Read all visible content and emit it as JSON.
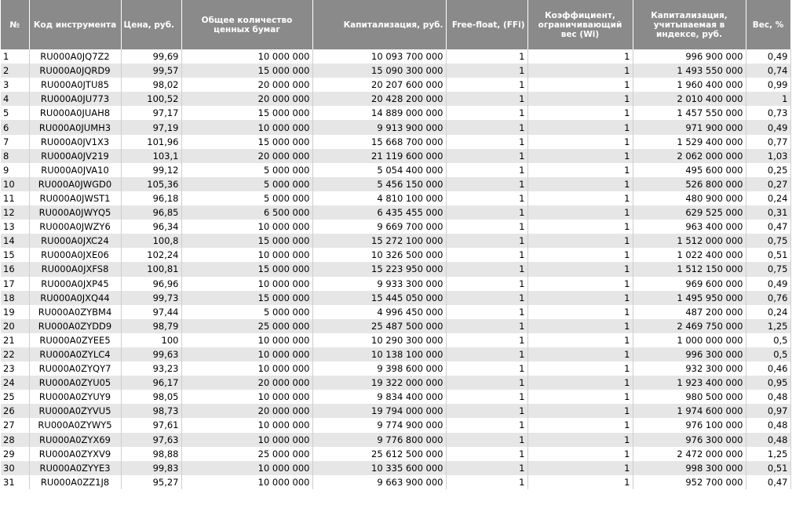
{
  "headers": [
    "№",
    "Код инструмента",
    "Цена, руб.",
    "Общее количество ценных бумаг",
    "Капитализация, руб.",
    "Free-float, (FFi)",
    "Коэффициент, ограничивающий вес (Wi)",
    "Капитализация, учитываемая в индексе, руб.",
    "Вес, %"
  ],
  "rows": [
    [
      "1",
      "RU000A0JQ7Z2",
      "99,69",
      "10 000 000",
      "10 093 700 000",
      "1",
      "1",
      "996 900 000",
      "0,49"
    ],
    [
      "2",
      "RU000A0JQRD9",
      "99,57",
      "15 000 000",
      "15 090 300 000",
      "1",
      "1",
      "1 493 550 000",
      "0,74"
    ],
    [
      "3",
      "RU000A0JTU85",
      "98,02",
      "20 000 000",
      "20 207 600 000",
      "1",
      "1",
      "1 960 400 000",
      "0,99"
    ],
    [
      "4",
      "RU000A0JU773",
      "100,52",
      "20 000 000",
      "20 428 200 000",
      "1",
      "1",
      "2 010 400 000",
      "1"
    ],
    [
      "5",
      "RU000A0JUAH8",
      "97,17",
      "15 000 000",
      "14 889 000 000",
      "1",
      "1",
      "1 457 550 000",
      "0,73"
    ],
    [
      "6",
      "RU000A0JUMH3",
      "97,19",
      "10 000 000",
      "9 913 900 000",
      "1",
      "1",
      "971 900 000",
      "0,49"
    ],
    [
      "7",
      "RU000A0JV1X3",
      "101,96",
      "15 000 000",
      "15 668 700 000",
      "1",
      "1",
      "1 529 400 000",
      "0,77"
    ],
    [
      "8",
      "RU000A0JV219",
      "103,1",
      "20 000 000",
      "21 119 600 000",
      "1",
      "1",
      "2 062 000 000",
      "1,03"
    ],
    [
      "9",
      "RU000A0JVA10",
      "99,12",
      "5 000 000",
      "5 054 400 000",
      "1",
      "1",
      "495 600 000",
      "0,25"
    ],
    [
      "10",
      "RU000A0JWGD0",
      "105,36",
      "5 000 000",
      "5 456 150 000",
      "1",
      "1",
      "526 800 000",
      "0,27"
    ],
    [
      "11",
      "RU000A0JWST1",
      "96,18",
      "5 000 000",
      "4 810 100 000",
      "1",
      "1",
      "480 900 000",
      "0,24"
    ],
    [
      "12",
      "RU000A0JWYQ5",
      "96,85",
      "6 500 000",
      "6 435 455 000",
      "1",
      "1",
      "629 525 000",
      "0,31"
    ],
    [
      "13",
      "RU000A0JWZY6",
      "96,34",
      "10 000 000",
      "9 669 700 000",
      "1",
      "1",
      "963 400 000",
      "0,47"
    ],
    [
      "14",
      "RU000A0JXC24",
      "100,8",
      "15 000 000",
      "15 272 100 000",
      "1",
      "1",
      "1 512 000 000",
      "0,75"
    ],
    [
      "15",
      "RU000A0JXE06",
      "102,24",
      "10 000 000",
      "10 326 500 000",
      "1",
      "1",
      "1 022 400 000",
      "0,51"
    ],
    [
      "16",
      "RU000A0JXFS8",
      "100,81",
      "15 000 000",
      "15 223 950 000",
      "1",
      "1",
      "1 512 150 000",
      "0,75"
    ],
    [
      "17",
      "RU000A0JXP45",
      "96,96",
      "10 000 000",
      "9 933 300 000",
      "1",
      "1",
      "969 600 000",
      "0,49"
    ],
    [
      "18",
      "RU000A0JXQ44",
      "99,73",
      "15 000 000",
      "15 445 050 000",
      "1",
      "1",
      "1 495 950 000",
      "0,76"
    ],
    [
      "19",
      "RU000A0ZYBM4",
      "97,44",
      "5 000 000",
      "4 996 450 000",
      "1",
      "1",
      "487 200 000",
      "0,24"
    ],
    [
      "20",
      "RU000A0ZYDD9",
      "98,79",
      "25 000 000",
      "25 487 500 000",
      "1",
      "1",
      "2 469 750 000",
      "1,25"
    ],
    [
      "21",
      "RU000A0ZYEE5",
      "100",
      "10 000 000",
      "10 290 300 000",
      "1",
      "1",
      "1 000 000 000",
      "0,5"
    ],
    [
      "22",
      "RU000A0ZYLC4",
      "99,63",
      "10 000 000",
      "10 138 100 000",
      "1",
      "1",
      "996 300 000",
      "0,5"
    ],
    [
      "23",
      "RU000A0ZYQY7",
      "93,23",
      "10 000 000",
      "9 398 600 000",
      "1",
      "1",
      "932 300 000",
      "0,46"
    ],
    [
      "24",
      "RU000A0ZYU05",
      "96,17",
      "20 000 000",
      "19 322 000 000",
      "1",
      "1",
      "1 923 400 000",
      "0,95"
    ],
    [
      "25",
      "RU000A0ZYUY9",
      "98,05",
      "10 000 000",
      "9 834 400 000",
      "1",
      "1",
      "980 500 000",
      "0,48"
    ],
    [
      "26",
      "RU000A0ZYVU5",
      "98,73",
      "20 000 000",
      "19 794 000 000",
      "1",
      "1",
      "1 974 600 000",
      "0,97"
    ],
    [
      "27",
      "RU000A0ZYWY5",
      "97,61",
      "10 000 000",
      "9 774 900 000",
      "1",
      "1",
      "976 100 000",
      "0,48"
    ],
    [
      "28",
      "RU000A0ZYX69",
      "97,63",
      "10 000 000",
      "9 776 800 000",
      "1",
      "1",
      "976 300 000",
      "0,48"
    ],
    [
      "29",
      "RU000A0ZYXV9",
      "98,88",
      "25 000 000",
      "25 612 500 000",
      "1",
      "1",
      "2 472 000 000",
      "1,25"
    ],
    [
      "30",
      "RU000A0ZYYE3",
      "99,83",
      "10 000 000",
      "10 335 600 000",
      "1",
      "1",
      "998 300 000",
      "0,51"
    ],
    [
      "31",
      "RU000A0ZZ1J8",
      "95,27",
      "10 000 000",
      "9 663 900 000",
      "1",
      "1",
      "952 700 000",
      "0,47"
    ]
  ]
}
